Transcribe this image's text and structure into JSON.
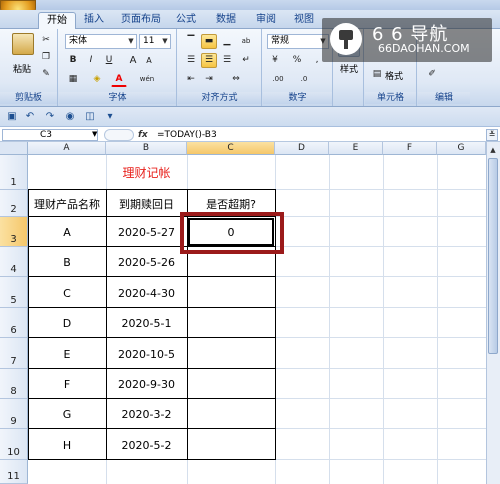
{
  "tabs": [
    "开始",
    "插入",
    "页面布局",
    "公式",
    "数据",
    "审阅",
    "视图"
  ],
  "ribbon": {
    "paste_label": "粘贴",
    "clipboard_group": "剪贴板",
    "font_name": "宋体",
    "font_size": "11",
    "font_group": "字体",
    "align_group": "对齐方式",
    "number_format": "常规",
    "percent": "%",
    "comma": ",",
    "number_group": "数字",
    "style_label": "样式",
    "format_label": "格式",
    "cells_group": "单元格",
    "edit_group": "编辑",
    "bold": "B",
    "italic": "I",
    "underline": "U",
    "font_grow": "A",
    "font_shrink": "A",
    "font_color_letter": "A",
    "phonetic": "wén",
    "orientation": "ab",
    "decimal_inc": ".00",
    "decimal_dec": ".0"
  },
  "formula_bar": {
    "name_box": "C3",
    "fx": "fx",
    "formula": "=TODAY()-B3"
  },
  "columns": [
    "A",
    "B",
    "C",
    "D",
    "E",
    "F",
    "G"
  ],
  "rows": [
    "1",
    "2",
    "3",
    "4",
    "5",
    "6",
    "7",
    "8",
    "9",
    "10",
    "11"
  ],
  "sheet": {
    "title": "理财记帐",
    "headers": [
      "理财产品名称",
      "到期赎回日",
      "是否超期?"
    ],
    "records": [
      {
        "name": "A",
        "date": "2020-5-27",
        "overdue": "0"
      },
      {
        "name": "B",
        "date": "2020-5-26",
        "overdue": ""
      },
      {
        "name": "C",
        "date": "2020-4-30",
        "overdue": ""
      },
      {
        "name": "D",
        "date": "2020-5-1",
        "overdue": ""
      },
      {
        "name": "E",
        "date": "2020-10-5",
        "overdue": ""
      },
      {
        "name": "F",
        "date": "2020-9-30",
        "overdue": ""
      },
      {
        "name": "G",
        "date": "2020-3-2",
        "overdue": ""
      },
      {
        "name": "H",
        "date": "2020-5-2",
        "overdue": ""
      }
    ]
  },
  "watermark": {
    "title": "6 6 导航",
    "subtitle": "66DAOHAN.COM"
  },
  "colors": {
    "title_red": "#e8211c",
    "highlight_box": "#9b1a1a",
    "selection": "#f5c76a"
  }
}
